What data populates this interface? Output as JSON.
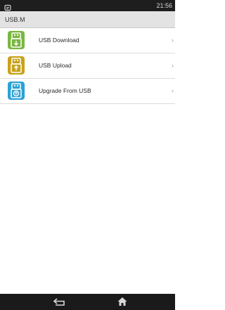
{
  "status_bar": {
    "time": "21:56",
    "icon": "notification-icon"
  },
  "header": {
    "title": "USB.M"
  },
  "menu": {
    "items": [
      {
        "label": "USB Download",
        "icon": "usb-download-icon",
        "color": "#7ab740",
        "chevron": "›"
      },
      {
        "label": "USB Upload",
        "icon": "usb-upload-icon",
        "color": "#c9a21a",
        "chevron": "›"
      },
      {
        "label": "Upgrade From USB",
        "icon": "usb-upgrade-icon",
        "color": "#2aa2d6",
        "chevron": "›"
      }
    ]
  },
  "nav_bar": {
    "back_icon": "back-icon",
    "home_icon": "home-icon"
  }
}
